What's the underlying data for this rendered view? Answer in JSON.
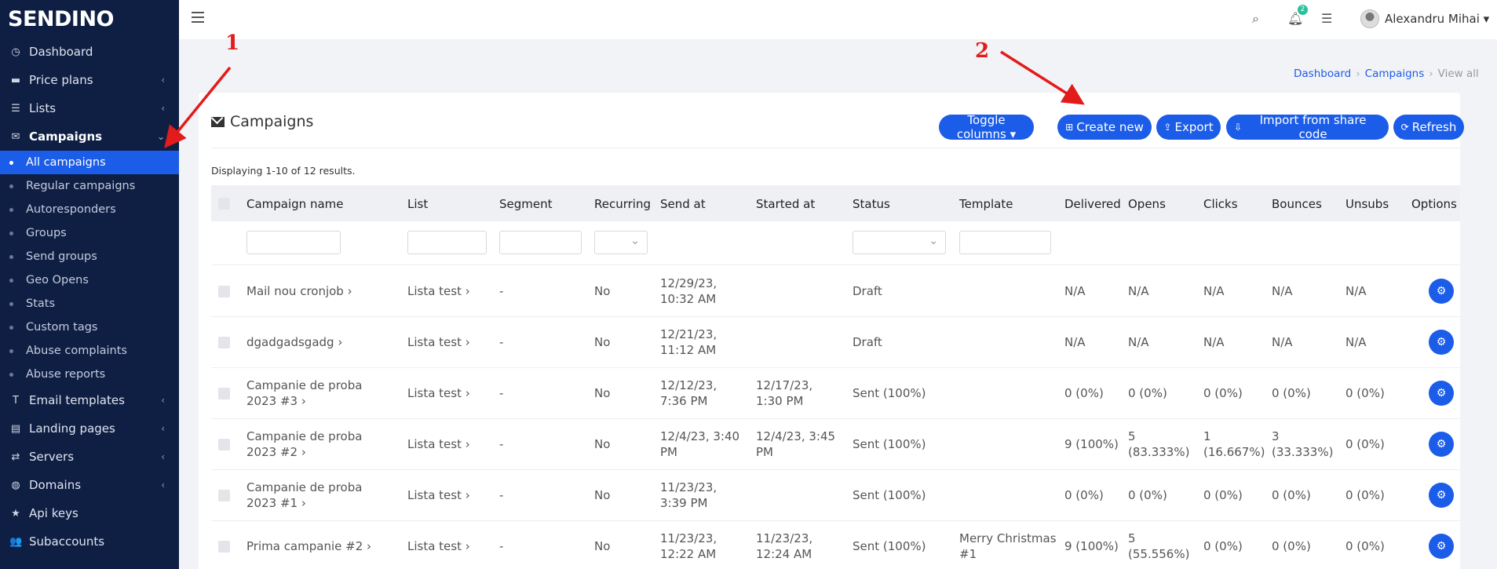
{
  "brand": {
    "name": "SENDINO"
  },
  "sidebar": {
    "items": [
      {
        "label": "Dashboard",
        "icon": "dashboard-icon",
        "glyph": "◷",
        "chev": ""
      },
      {
        "label": "Price plans",
        "icon": "price-plans-icon",
        "glyph": "▬",
        "chev": "‹"
      },
      {
        "label": "Lists",
        "icon": "lists-icon",
        "glyph": "☰",
        "chev": "‹"
      },
      {
        "label": "Campaigns",
        "icon": "envelope-icon",
        "glyph": "✉",
        "chev": "⌄"
      }
    ],
    "campaign_sub": [
      "All campaigns",
      "Regular campaigns",
      "Autoresponders",
      "Groups",
      "Send groups",
      "Geo Opens",
      "Stats",
      "Custom tags",
      "Abuse complaints",
      "Abuse reports"
    ],
    "items_after": [
      {
        "label": "Email templates",
        "icon": "text-icon",
        "glyph": "T",
        "chev": "‹"
      },
      {
        "label": "Landing pages",
        "icon": "landing-pages-icon",
        "glyph": "▤",
        "chev": "‹"
      },
      {
        "label": "Servers",
        "icon": "servers-icon",
        "glyph": "⇄",
        "chev": "‹"
      },
      {
        "label": "Domains",
        "icon": "globe-icon",
        "glyph": "◍",
        "chev": "‹"
      },
      {
        "label": "Api keys",
        "icon": "star-icon",
        "glyph": "★",
        "chev": ""
      },
      {
        "label": "Subaccounts",
        "icon": "users-icon",
        "glyph": "👥",
        "chev": ""
      }
    ]
  },
  "topbar": {
    "notification_count": "2",
    "user_name": "Alexandru Mihai ▾"
  },
  "breadcrumb": {
    "dashboard": "Dashboard",
    "campaigns": "Campaigns",
    "current": "View all",
    "sep": "›"
  },
  "card": {
    "title": "Campaigns",
    "buttons": {
      "toggle": "Toggle columns ▾",
      "create": "Create new",
      "export": "Export",
      "import": "Import from share code",
      "refresh": "Refresh"
    },
    "summary": "Displaying 1-10 of 12 results."
  },
  "table": {
    "headers": {
      "name": "Campaign name",
      "list": "List",
      "segment": "Segment",
      "recurring": "Recurring",
      "send_at": "Send at",
      "started_at": "Started at",
      "status": "Status",
      "template": "Template",
      "delivered": "Delivered",
      "opens": "Opens",
      "clicks": "Clicks",
      "bounces": "Bounces",
      "unsubs": "Unsubs",
      "options": "Options"
    },
    "rows": [
      {
        "name": "Mail nou cronjob ›",
        "list": "Lista test ›",
        "segment": "-",
        "recurring": "No",
        "send_at": "12/29/23, 10:32 AM",
        "started_at": "",
        "status": "Draft",
        "template": "",
        "delivered": "N/A",
        "opens": "N/A",
        "clicks": "N/A",
        "bounces": "N/A",
        "unsubs": "N/A"
      },
      {
        "name": "dgadgadsgadg ›",
        "list": "Lista test ›",
        "segment": "-",
        "recurring": "No",
        "send_at": "12/21/23, 11:12 AM",
        "started_at": "",
        "status": "Draft",
        "template": "",
        "delivered": "N/A",
        "opens": "N/A",
        "clicks": "N/A",
        "bounces": "N/A",
        "unsubs": "N/A"
      },
      {
        "name": "Campanie de proba 2023 #3 ›",
        "list": "Lista test ›",
        "segment": "-",
        "recurring": "No",
        "send_at": "12/12/23, 7:36 PM",
        "started_at": "12/17/23, 1:30 PM",
        "status": "Sent (100%)",
        "template": "",
        "delivered": "0 (0%)",
        "opens": "0 (0%)",
        "clicks": "0 (0%)",
        "bounces": "0 (0%)",
        "unsubs": "0 (0%)"
      },
      {
        "name": "Campanie de proba 2023 #2 ›",
        "list": "Lista test ›",
        "segment": "-",
        "recurring": "No",
        "send_at": "12/4/23, 3:40 PM",
        "started_at": "12/4/23, 3:45 PM",
        "status": "Sent (100%)",
        "template": "",
        "delivered": "9 (100%)",
        "opens": "5 (83.333%)",
        "clicks": "1 (16.667%)",
        "bounces": "3 (33.333%)",
        "unsubs": "0 (0%)"
      },
      {
        "name": "Campanie de proba 2023 #1 ›",
        "list": "Lista test ›",
        "segment": "-",
        "recurring": "No",
        "send_at": "11/23/23, 3:39 PM",
        "started_at": "",
        "status": "Sent (100%)",
        "template": "",
        "delivered": "0 (0%)",
        "opens": "0 (0%)",
        "clicks": "0 (0%)",
        "bounces": "0 (0%)",
        "unsubs": "0 (0%)"
      },
      {
        "name": "Prima campanie #2 ›",
        "list": "Lista test ›",
        "segment": "-",
        "recurring": "No",
        "send_at": "11/23/23, 12:22 AM",
        "started_at": "11/23/23, 12:24 AM",
        "status": "Sent (100%)",
        "template": "Merry Christmas #1",
        "delivered": "9 (100%)",
        "opens": "5 (55.556%)",
        "clicks": "0 (0%)",
        "bounces": "0 (0%)",
        "unsubs": "0 (0%)"
      }
    ]
  },
  "annotations": {
    "one": "1",
    "two": "2",
    "color": "#e21b1b"
  }
}
